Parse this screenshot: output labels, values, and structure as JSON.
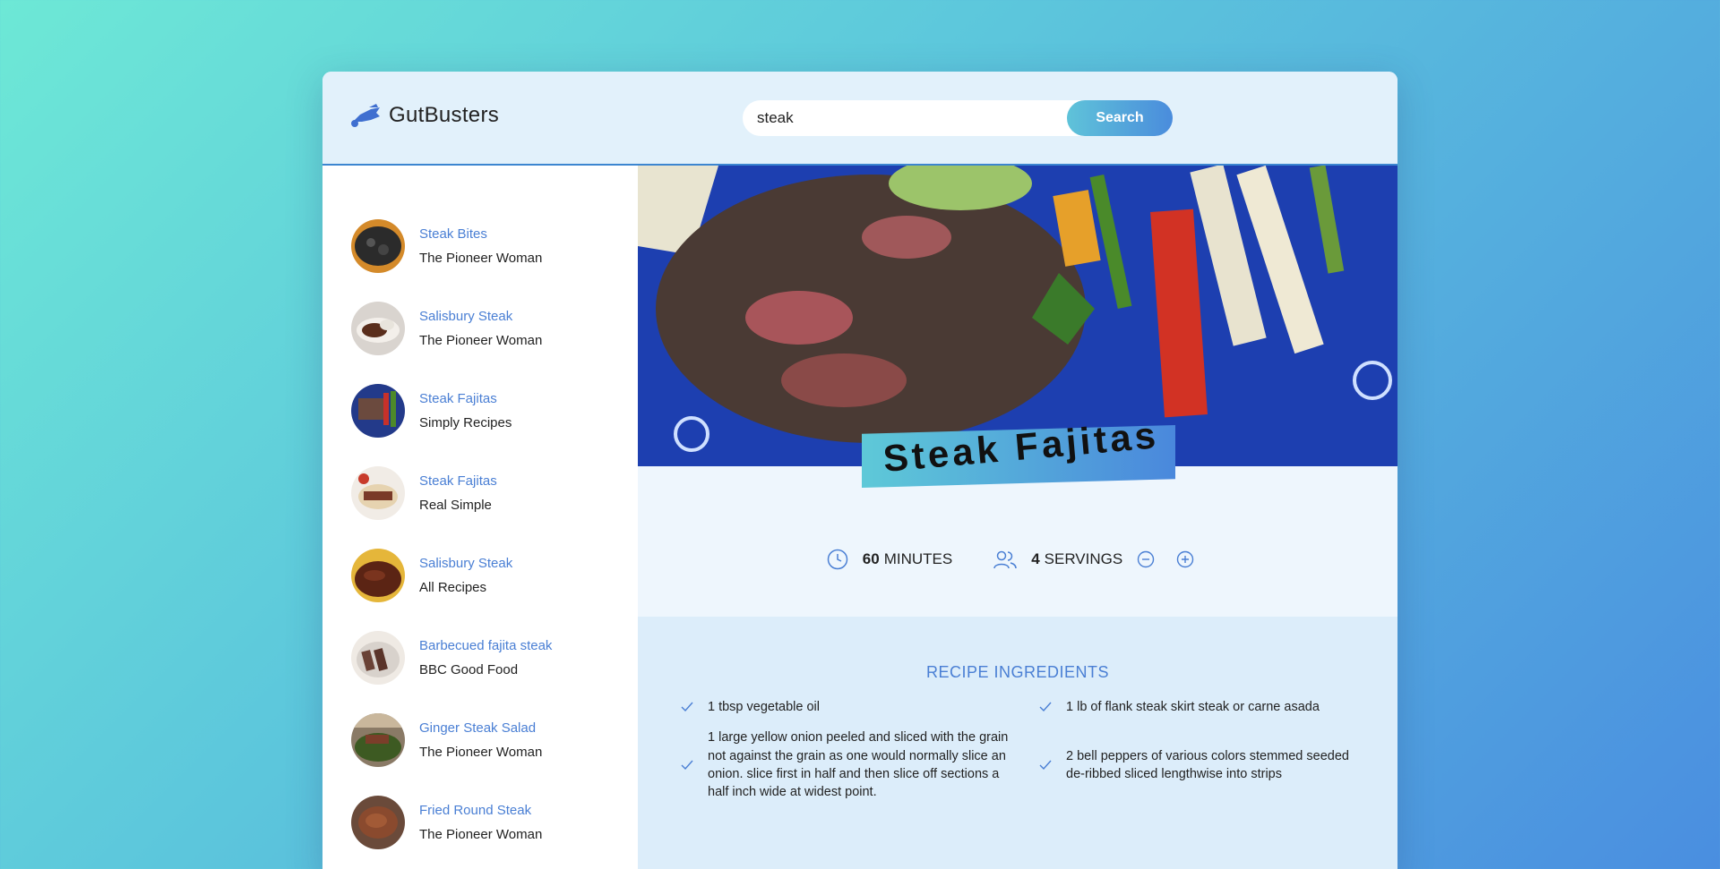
{
  "app": {
    "name": "GutBusters"
  },
  "search": {
    "value": "steak",
    "button_label": "Search"
  },
  "results": [
    {
      "title": "Steak Bites",
      "publisher": "The Pioneer Woman"
    },
    {
      "title": "Salisbury Steak",
      "publisher": "The Pioneer Woman"
    },
    {
      "title": "Steak Fajitas",
      "publisher": "Simply Recipes"
    },
    {
      "title": "Steak Fajitas",
      "publisher": "Real Simple"
    },
    {
      "title": "Salisbury Steak",
      "publisher": "All Recipes"
    },
    {
      "title": "Barbecued fajita steak",
      "publisher": "BBC Good Food"
    },
    {
      "title": "Ginger Steak Salad",
      "publisher": "The Pioneer Woman"
    },
    {
      "title": "Fried Round Steak",
      "publisher": "The Pioneer Woman"
    }
  ],
  "recipe": {
    "title": "Steak Fajitas",
    "minutes": "60",
    "minutes_label": "MINUTES",
    "servings": "4",
    "servings_label": "SERVINGS",
    "ingredients_heading": "RECIPE INGREDIENTS",
    "ingredients": [
      "1 tbsp vegetable oil",
      "1 lb of flank steak skirt steak or carne asada",
      "1 large yellow onion peeled and sliced with the grain not against the grain as one would normally slice an onion. slice first in half and then slice off sections a half inch wide at widest point.",
      "2 bell peppers of various colors stemmed seeded de-ribbed sliced lengthwise into strips"
    ]
  },
  "colors": {
    "accent": "#4a7fd4",
    "header_bg": "#e2f1fb"
  }
}
